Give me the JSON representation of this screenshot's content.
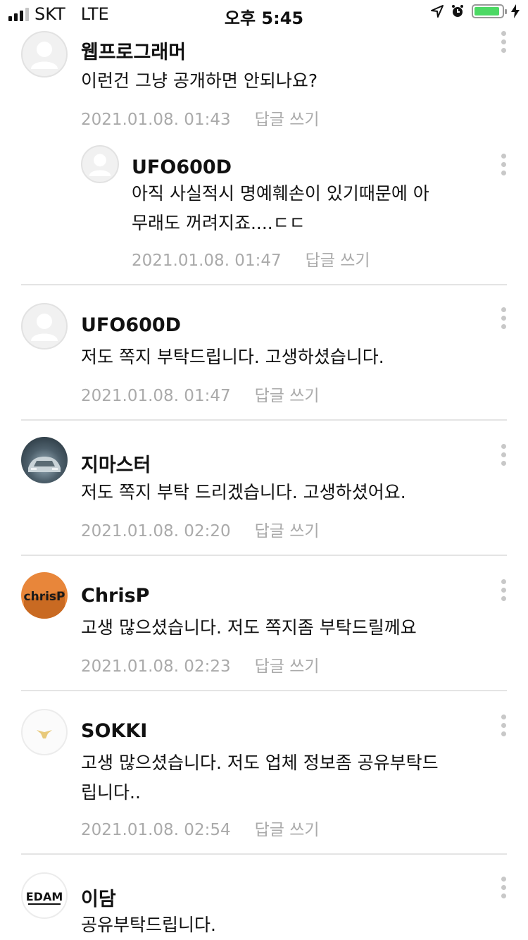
{
  "status_bar": {
    "carrier": "SKT",
    "network": "LTE",
    "time": "오후 5:45",
    "battery_color": "#4cd964"
  },
  "comments": [
    {
      "author": "웹프로그래머",
      "text_lines": [
        "이런건 그냥 공개하면 안되나요?"
      ],
      "date": "2021.01.08. 01:43",
      "reply_label": "답글 쓰기",
      "avatar": "default-person-icon"
    },
    {
      "author": "UFO600D",
      "text_lines": [
        "아직 사실적시 명예훼손이 있기때문에 아",
        "무래도 꺼려지죠....ㄷㄷ"
      ],
      "date": "2021.01.08. 01:47",
      "reply_label": "답글 쓰기",
      "avatar": "default-person-icon",
      "is_reply": true
    },
    {
      "author": "UFO600D",
      "text_lines": [
        "저도 쪽지 부탁드립니다. 고생하셨습니다."
      ],
      "date": "2021.01.08. 01:47",
      "reply_label": "답글 쓰기",
      "avatar": "default-person-icon"
    },
    {
      "author": "지마스터",
      "text_lines": [
        "저도 쪽지 부탁 드리겠습니다. 고생하셨어요."
      ],
      "date": "2021.01.08. 02:20",
      "reply_label": "답글 쓰기",
      "avatar": "car-photo-avatar"
    },
    {
      "author": "ChrisP",
      "text_lines": [
        "고생 많으셨습니다. 저도 쪽지좀 부탁드릴께요"
      ],
      "date": "2021.01.08. 02:23",
      "reply_label": "답글 쓰기",
      "avatar": "chrisp-logo-avatar",
      "avatar_text": "chrisP"
    },
    {
      "author": "SOKKI",
      "text_lines": [
        "고생 많으셨습니다. 저도 업체 정보좀 공유부탁드",
        "립니다.."
      ],
      "date": "2021.01.08. 02:54",
      "reply_label": "답글 쓰기",
      "avatar": "bird-logo-avatar"
    },
    {
      "author": "이담",
      "text_lines": [
        "공유부탁드립니다."
      ],
      "avatar": "edam-logo-avatar",
      "avatar_text": "EDAM"
    }
  ]
}
